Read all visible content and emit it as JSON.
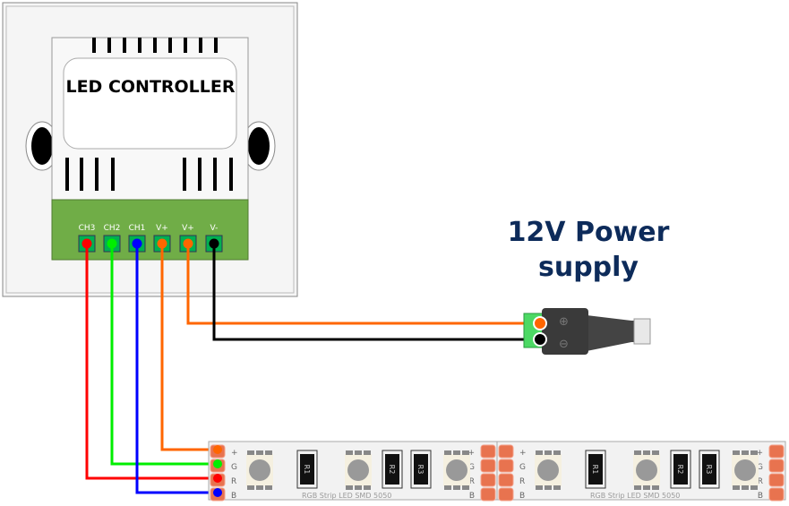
{
  "controller": {
    "title": "LED CONTROLLER",
    "terminals": [
      {
        "label": "CH3",
        "wire_color": "#ff0000"
      },
      {
        "label": "CH2",
        "wire_color": "#00ee00"
      },
      {
        "label": "CH1",
        "wire_color": "#0000ff"
      },
      {
        "label": "V+",
        "wire_color": "#ff6600"
      },
      {
        "label": "V+",
        "wire_color": "#ff6600"
      },
      {
        "label": "V-",
        "wire_color": "#000000"
      }
    ],
    "terminal_block_color": "#70ad47"
  },
  "power_supply": {
    "title_line1": "12V Power",
    "title_line2": "supply",
    "title_color": "#0d2b5a",
    "plus_symbol": "⊕",
    "minus_symbol": "⊖"
  },
  "strip": {
    "pad_labels": [
      "+",
      "G",
      "R",
      "B"
    ],
    "resistors": [
      "R1",
      "R2",
      "R3"
    ],
    "label": "RGB Strip LED SMD 5050",
    "segments": 2
  }
}
